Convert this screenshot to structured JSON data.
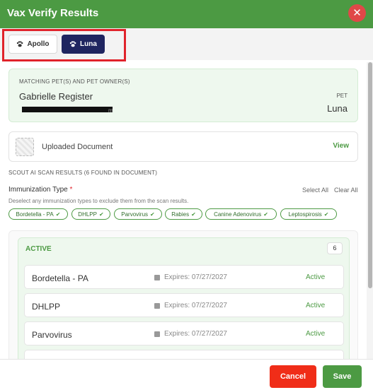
{
  "dialog": {
    "title": "Vax Verify Results",
    "close_label": "✕"
  },
  "pets": [
    {
      "label": "Apollo",
      "selected": false
    },
    {
      "label": "Luna",
      "selected": true
    }
  ],
  "match": {
    "heading": "MATCHING PET(S) AND PET OWNER(S)",
    "owner_name": "Gabrielle Register",
    "email_tail": "m",
    "pet_heading": "PET",
    "pet_name": "Luna"
  },
  "document": {
    "label": "Uploaded Document",
    "view_label": "View"
  },
  "scan": {
    "heading": "SCOUT AI SCAN RESULTS (6 FOUND IN DOCUMENT)",
    "type_label": "Immunization Type",
    "required_mark": "*",
    "select_all": "Select All",
    "clear_all": "Clear All",
    "help_text": "Deselect any immunization types to exclude them from the scan results.",
    "chips": [
      "Bordetella - PA",
      "DHLPP",
      "Parvovirus",
      "Rabies",
      "Canine Adenovirus",
      "Leptospirosis"
    ]
  },
  "active": {
    "title": "ACTIVE",
    "count": "6",
    "rows": [
      {
        "name": "Bordetella - PA",
        "expires": "Expires: 07/27/2027",
        "status": "Active"
      },
      {
        "name": "DHLPP",
        "expires": "Expires: 07/27/2027",
        "status": "Active"
      },
      {
        "name": "Parvovirus",
        "expires": "Expires: 07/27/2027",
        "status": "Active"
      }
    ]
  },
  "footer": {
    "cancel_label": "Cancel",
    "save_label": "Save"
  },
  "colors": {
    "brand_green": "#4c9a43",
    "navy": "#1f2560",
    "danger": "#f02d18"
  }
}
